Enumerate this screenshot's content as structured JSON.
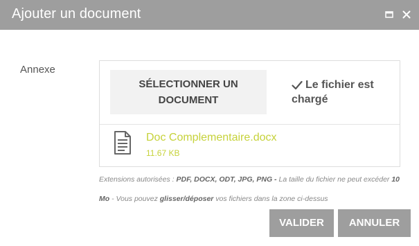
{
  "dialog": {
    "title": "Ajouter un document"
  },
  "form": {
    "field_label": "Annexe",
    "select_button_line1": "SÉLECTIONNER UN",
    "select_button_line2": "DOCUMENT",
    "status_line1": "Le fichier est",
    "status_line2": "chargé",
    "file": {
      "name": "Doc Complementaire.docx",
      "size": "11.67 KB"
    },
    "help": {
      "t1": "Extensions autorisées : ",
      "b1": "PDF, DOCX, ODT, JPG, PNG -",
      "t2": " La taille du fichier ne peut excéder ",
      "b2": "10 Mo",
      "t3": " - Vous pouvez ",
      "b3": "glisser/déposer",
      "t4": " vos fichiers dans la zone ci-dessus"
    }
  },
  "actions": {
    "validate_label": "VALIDER",
    "cancel_label": "ANNULER"
  },
  "colors": {
    "titlebar": "#9e9e9e",
    "file_accent": "#c6d23a",
    "button": "#9e9e9e"
  },
  "icons": {
    "maximize": "window-maximize-icon",
    "close": "close-icon",
    "check": "check-icon",
    "file": "document-icon"
  }
}
